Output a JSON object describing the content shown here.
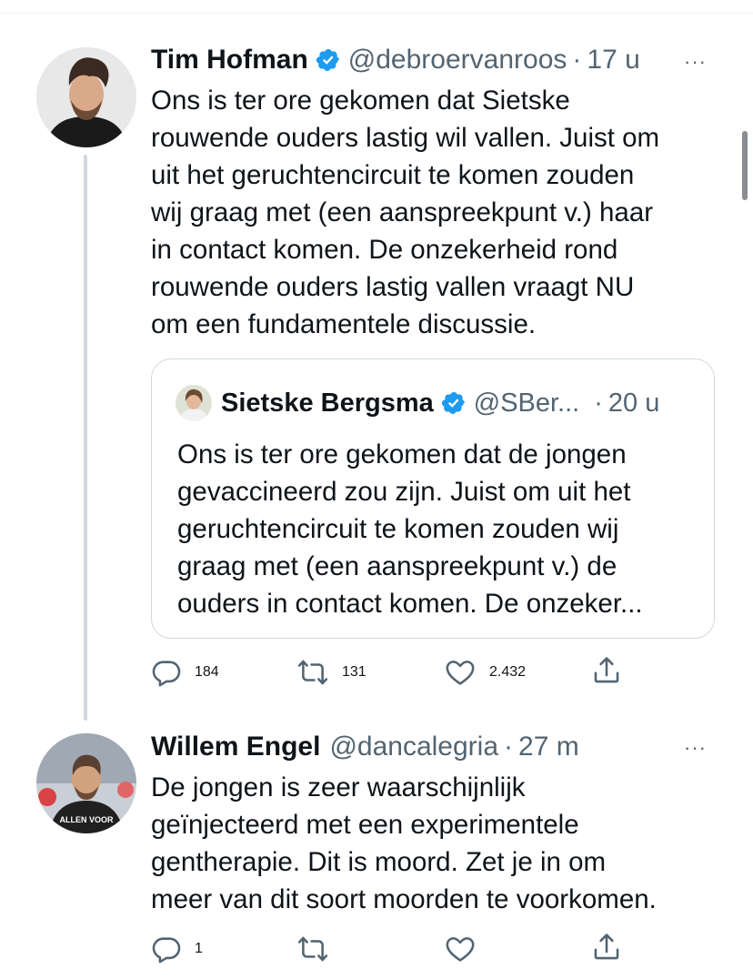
{
  "tweets": [
    {
      "name": "Tim Hofman",
      "handle": "@debroervanroos",
      "separator": "·",
      "time": "17 u",
      "text": "Ons is ter ore gekomen dat Sietske\nrouwende ouders lastig wil vallen. Juist om\nuit het geruchtencircuit te komen zouden\nwij graag met (een aanspreekpunt v.) haar\nin contact komen. De onzekerheid rond\nrouwende ouders lastig vallen vraagt NU\nom een fundamentele discussie.",
      "quote": {
        "name": "Sietske Bergsma",
        "handle": "@SBer...",
        "separator": "·",
        "time": "20 u",
        "text": "Ons is ter ore gekomen dat de jongen\ngevaccineerd zou zijn. Juist om uit het\ngeruchtencircuit te komen zouden wij\ngraag met (een aanspreekpunt v.) de\nouders in contact komen. De onzeker..."
      },
      "replies": "184",
      "retweets": "131",
      "likes": "2.432"
    },
    {
      "name": "Willem Engel",
      "handle": "@dancalegria",
      "separator": "·",
      "time": "27 m",
      "avatar_shirt_text": "ALLEN VOOR",
      "text": "De jongen is zeer waarschijnlijk\ngeïnjecteerd met een experimentele\ngentherapie. Dit is moord. Zet je in om\nmeer van dit soort moorden te voorkomen.",
      "replies": "1",
      "retweets": "",
      "likes": ""
    }
  ],
  "more_label": "···",
  "colors": {
    "verified": "#1d9bf0",
    "secondary": "#536471",
    "border": "#cfd9de"
  }
}
